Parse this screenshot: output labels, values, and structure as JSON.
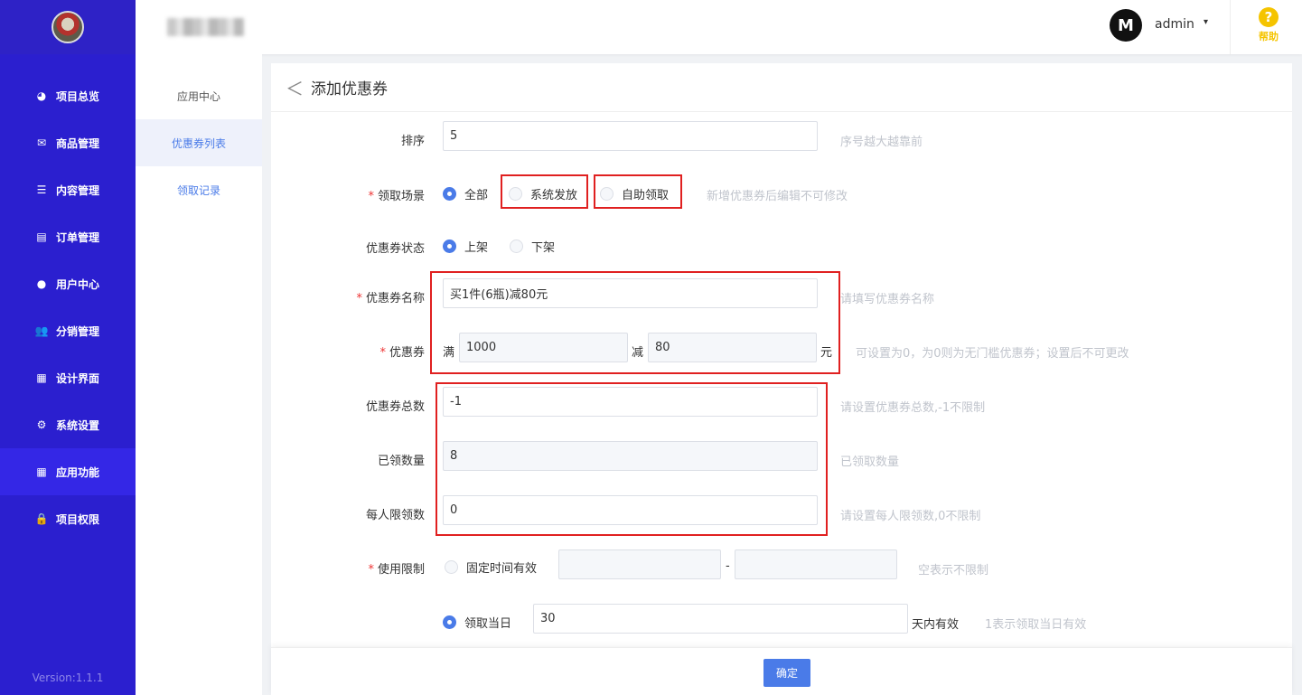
{
  "sidebar": {
    "items": [
      {
        "label": "项目总览",
        "icon": "pie-chart-icon",
        "glyph": "◕"
      },
      {
        "label": "商品管理",
        "icon": "envelope-icon",
        "glyph": "✉"
      },
      {
        "label": "内容管理",
        "icon": "list-icon",
        "glyph": "☰"
      },
      {
        "label": "订单管理",
        "icon": "document-icon",
        "glyph": "▤"
      },
      {
        "label": "用户中心",
        "icon": "user-icon",
        "glyph": "●"
      },
      {
        "label": "分销管理",
        "icon": "users-icon",
        "glyph": "👥"
      },
      {
        "label": "设计界面",
        "icon": "layout-icon",
        "glyph": "▦"
      },
      {
        "label": "系统设置",
        "icon": "gear-icon",
        "glyph": "⚙"
      },
      {
        "label": "应用功能",
        "icon": "grid-icon",
        "glyph": "▦",
        "active": true
      },
      {
        "label": "项目权限",
        "icon": "lock-icon",
        "glyph": "🔒"
      }
    ],
    "version": "Version:1.1.1"
  },
  "header": {
    "user_name": "admin",
    "avatar_letter": "M",
    "help_label": "帮助",
    "help_glyph": "?",
    "caret": "▾"
  },
  "submenu": {
    "items": [
      "应用中心",
      "优惠券列表",
      "领取记录"
    ]
  },
  "page": {
    "back_glyph": "＜",
    "title": "添加优惠券"
  },
  "form": {
    "sort": {
      "label": "排序",
      "value": "5",
      "hint": "序号越大越靠前"
    },
    "scene": {
      "label": "领取场景",
      "options": [
        "全部",
        "系统发放",
        "自助领取"
      ],
      "selected": "全部",
      "hint": "新增优惠券后编辑不可修改"
    },
    "status": {
      "label": "优惠券状态",
      "options": [
        "上架",
        "下架"
      ],
      "selected": "上架"
    },
    "name": {
      "label": "优惠券名称",
      "value": "买1件(6瓶)减80元",
      "hint": "请填写优惠券名称"
    },
    "coupon": {
      "label": "优惠券",
      "full_prefix": "满",
      "full_value": "1000",
      "minus_prefix": "减",
      "minus_value": "80",
      "unit": "元",
      "hint": "可设置为0，为0则为无门槛优惠券；设置后不可更改"
    },
    "total": {
      "label": "优惠券总数",
      "value": "-1",
      "hint": "请设置优惠券总数,-1不限制"
    },
    "received": {
      "label": "已领数量",
      "value": "8",
      "hint": "已领取数量"
    },
    "per_person": {
      "label": "每人限领数",
      "value": "0",
      "hint": "请设置每人限领数,0不限制"
    },
    "usage": {
      "label": "使用限制",
      "fixed_option": "固定时间有效",
      "range_sep": "-",
      "fixed_hint": "空表示不限制",
      "day_option": "领取当日",
      "day_value": "30",
      "day_suffix": "天内有效",
      "day_hint": "1表示领取当日有效"
    },
    "required_mark": "*"
  },
  "footer": {
    "confirm_label": "确定"
  },
  "colors": {
    "sidebar_bg": "#2b1fcf",
    "accent": "#4a7be8",
    "highlight_box": "#e02020",
    "help": "#f5c400"
  }
}
